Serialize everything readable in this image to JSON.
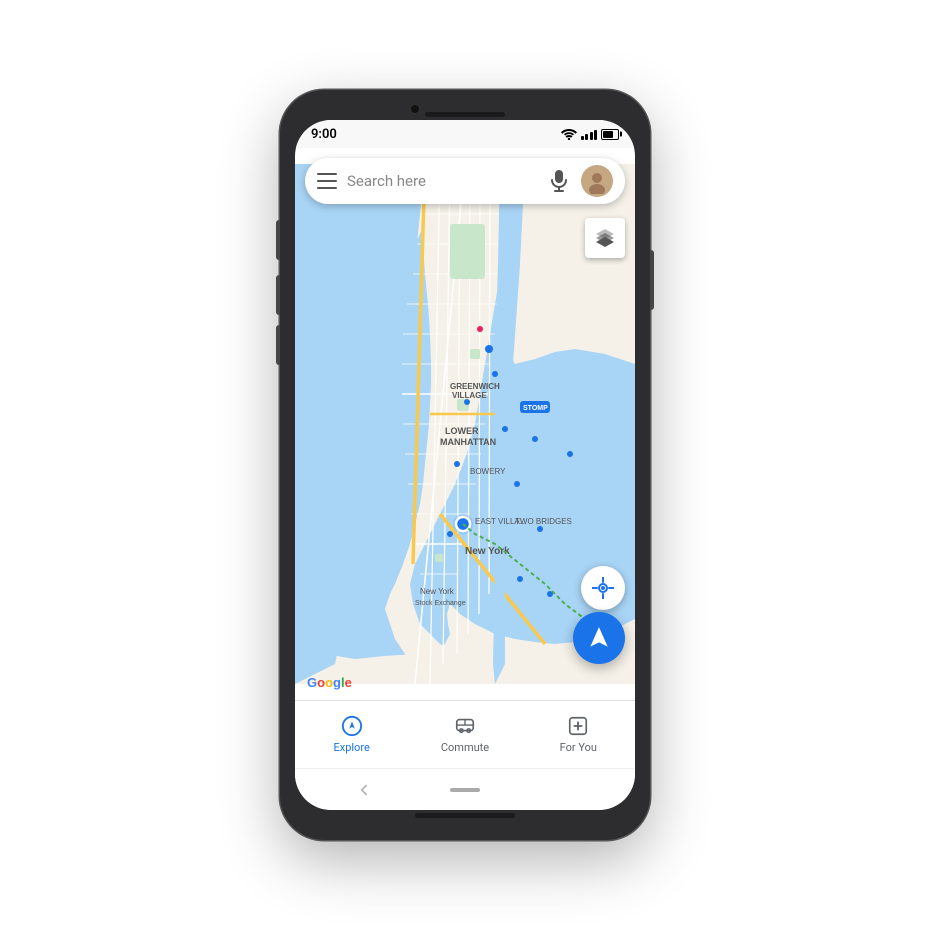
{
  "phone": {
    "status_bar": {
      "time": "9:00",
      "wifi": true,
      "signal": true,
      "battery": true
    },
    "search": {
      "placeholder": "Search here"
    },
    "map": {
      "location": "New York",
      "google_logo_text": "Google"
    },
    "bottom_nav": {
      "items": [
        {
          "id": "explore",
          "label": "Explore",
          "active": true
        },
        {
          "id": "commute",
          "label": "Commute",
          "active": false
        },
        {
          "id": "for-you",
          "label": "For You",
          "active": false
        }
      ]
    },
    "buttons": {
      "layers": "Layers",
      "location": "My Location",
      "navigate": "Navigate"
    },
    "colors": {
      "accent": "#1a73e8",
      "nav_active": "#1a73e8",
      "nav_inactive": "#5f6368"
    }
  }
}
